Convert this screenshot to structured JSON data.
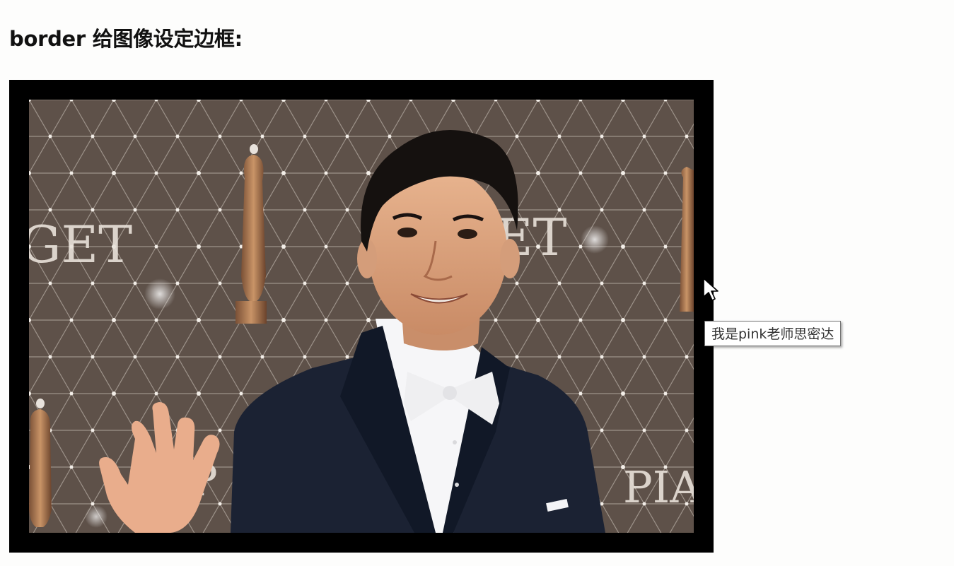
{
  "heading": {
    "text": "border 给图像设定边框:"
  },
  "image": {
    "description_icon": "portrait-photo",
    "border_color": "#000000",
    "backdrop_text_left": "GET",
    "backdrop_text_center": "ET",
    "backdrop_text_bottom_left": "P",
    "backdrop_text_bottom_right": "PIA"
  },
  "tooltip": {
    "text": "我是pink老师思密达"
  },
  "cursor": {
    "icon": "mouse-pointer-icon"
  }
}
